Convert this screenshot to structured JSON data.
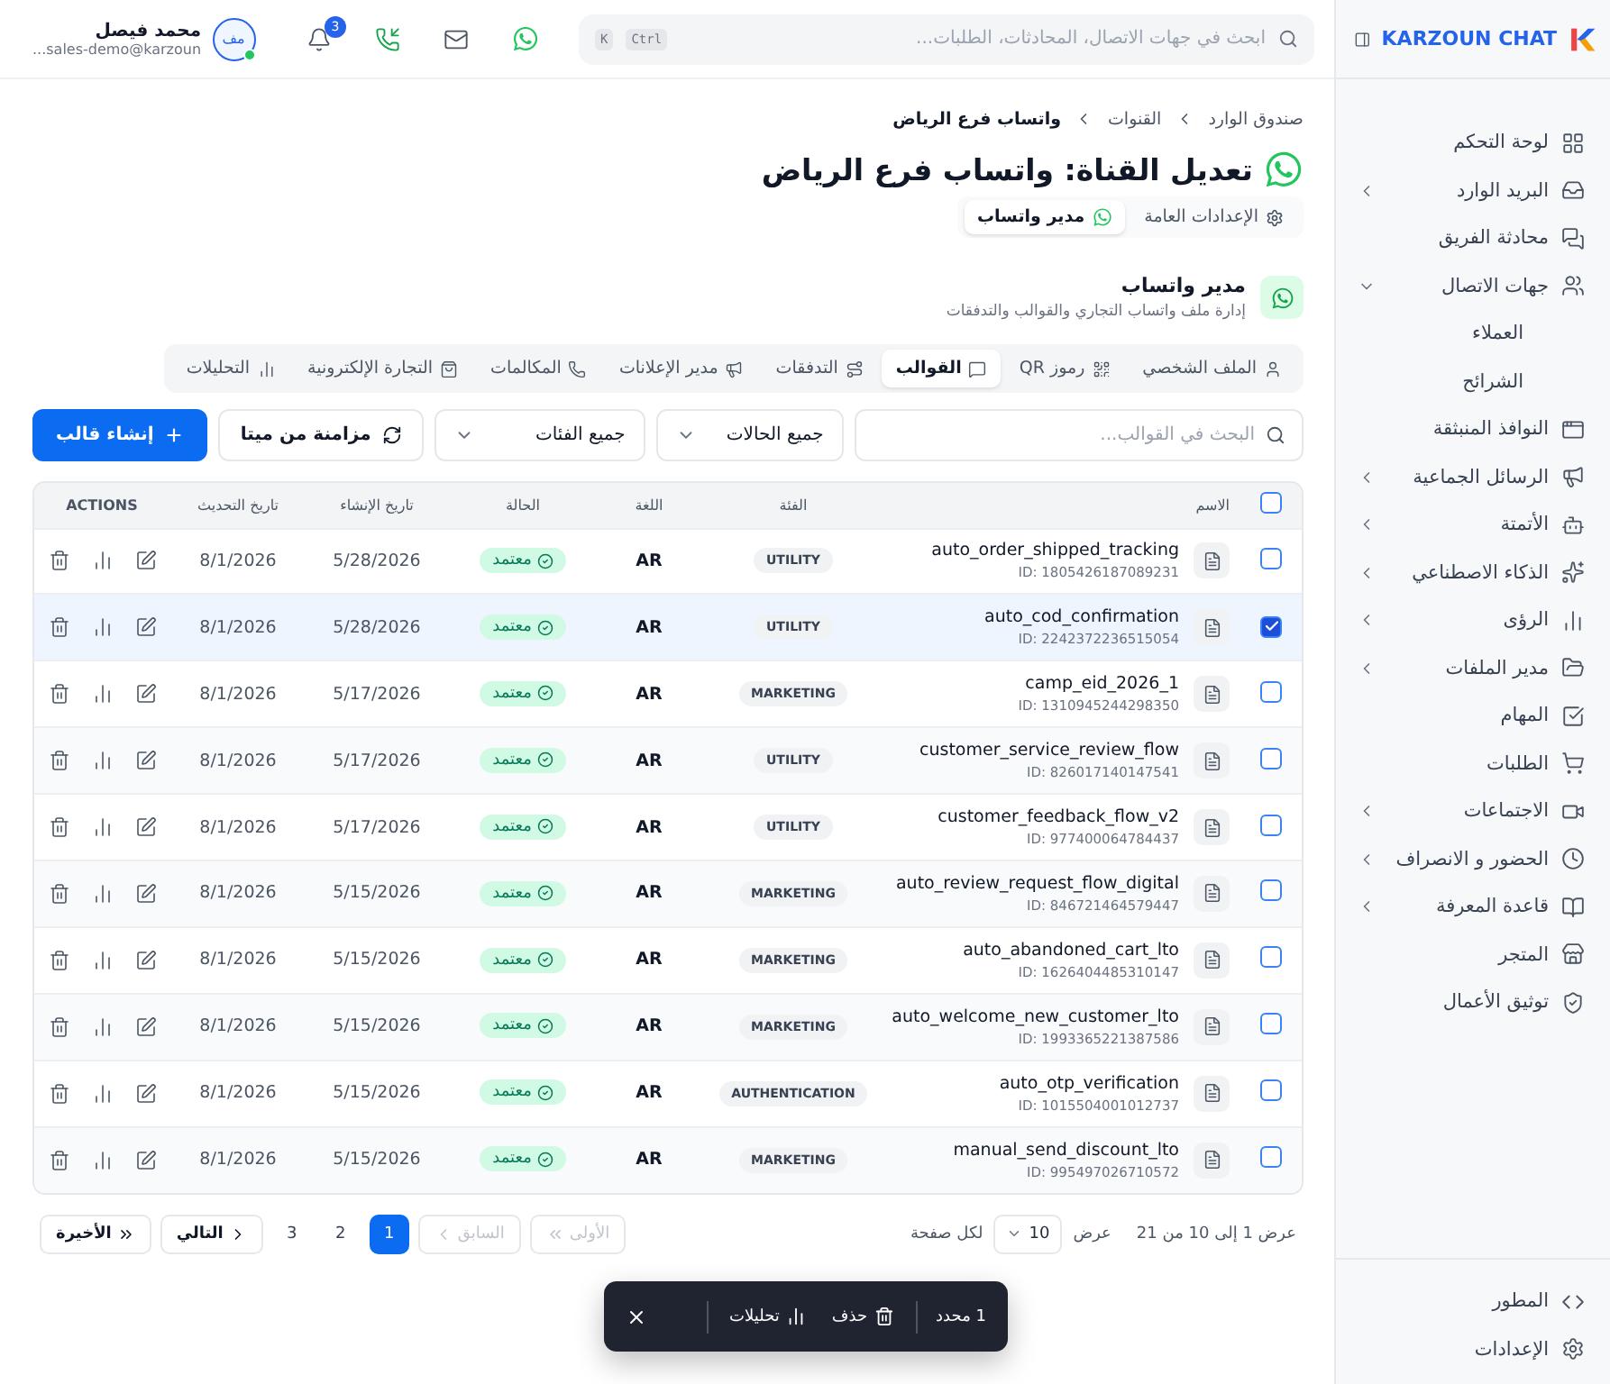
{
  "sidebar": {
    "logo": "KARZOUN CHAT",
    "items": [
      {
        "label": "لوحة التحكم"
      },
      {
        "label": "البريد الوارد",
        "expanded": false
      },
      {
        "label": "محادثة الفريق"
      },
      {
        "label": "جهات الاتصال",
        "expanded": true,
        "children": [
          {
            "label": "العملاء"
          },
          {
            "label": "الشرائح"
          }
        ]
      },
      {
        "label": "النوافذ المنبثقة"
      },
      {
        "label": "الرسائل الجماعية",
        "expanded": false
      },
      {
        "label": "الأتمتة",
        "expanded": false
      },
      {
        "label": "الذكاء الاصطناعي",
        "expanded": false
      },
      {
        "label": "الرؤى",
        "expanded": false
      },
      {
        "label": "مدير الملفات",
        "expanded": false
      },
      {
        "label": "المهام"
      },
      {
        "label": "الطلبات"
      },
      {
        "label": "الاجتماعات",
        "expanded": false
      },
      {
        "label": "الحضور و الانصراف",
        "expanded": false
      },
      {
        "label": "قاعدة المعرفة",
        "expanded": false
      },
      {
        "label": "المتجر"
      },
      {
        "label": "توثيق الأعمال"
      }
    ],
    "footer": [
      {
        "label": "المطور"
      },
      {
        "label": "الإعدادات"
      }
    ]
  },
  "header": {
    "search": {
      "placeholder": "ابحث في جهات الاتصال، المحادثات، الطلبات...",
      "keys": [
        "Ctrl",
        "K"
      ]
    },
    "notifications": "3",
    "user": {
      "initials": "مف",
      "name": "محمد فيصل",
      "email": "sales-demo@karzoun...",
      "online": true
    }
  },
  "breadcrumb": [
    "صندوق الوارد",
    "القنوات",
    "واتساب فرع الرياض"
  ],
  "title": "تعديل القناة: واتساب فرع الرياض",
  "channel_tabs": [
    {
      "label": "الإعدادات العامة",
      "selected": false
    },
    {
      "label": "مدير واتساب",
      "selected": true
    }
  ],
  "section": {
    "title": "مدير واتساب",
    "subtitle": "إدارة ملف واتساب التجاري والقوالب والتدفقات"
  },
  "tabs": [
    {
      "label": "الملف الشخصي",
      "selected": false
    },
    {
      "label": "رموز QR",
      "selected": false
    },
    {
      "label": "القوالب",
      "selected": true
    },
    {
      "label": "التدفقات",
      "selected": false
    },
    {
      "label": "مدير الإعلانات",
      "selected": false
    },
    {
      "label": "المكالمات",
      "selected": false
    },
    {
      "label": "التجارة الإلكترونية",
      "selected": false
    },
    {
      "label": "التحليلات",
      "selected": false
    }
  ],
  "toolbar": {
    "search_placeholder": "البحث في القوالب...",
    "filters": [
      "جميع الحالات",
      "جميع الفئات"
    ],
    "sync": "مزامنة من ميتا",
    "create": "إنشاء قالب"
  },
  "table": {
    "select_all": false,
    "columns": [
      "الاسم",
      "الفئة",
      "اللغة",
      "الحالة",
      "تاريخ الإنشاء",
      "تاريخ التحديث",
      "ACTIONS"
    ],
    "rows": [
      {
        "name": "auto_order_shipped_tracking",
        "id": "ID: 1805426187089231",
        "category": "UTILITY",
        "language": "AR",
        "status": "معتمد",
        "created": "5/28/2026",
        "updated": "8/1/2026",
        "selected": false
      },
      {
        "name": "auto_cod_confirmation",
        "id": "ID: 2242372236515054",
        "category": "UTILITY",
        "language": "AR",
        "status": "معتمد",
        "created": "5/28/2026",
        "updated": "8/1/2026",
        "selected": true
      },
      {
        "name": "camp_eid_2026_1",
        "id": "ID: 1310945244298350",
        "category": "MARKETING",
        "language": "AR",
        "status": "معتمد",
        "created": "5/17/2026",
        "updated": "8/1/2026",
        "selected": false
      },
      {
        "name": "customer_service_review_flow",
        "id": "ID: 826017140147541",
        "category": "UTILITY",
        "language": "AR",
        "status": "معتمد",
        "created": "5/17/2026",
        "updated": "8/1/2026",
        "selected": false
      },
      {
        "name": "customer_feedback_flow_v2",
        "id": "ID: 977400064784437",
        "category": "UTILITY",
        "language": "AR",
        "status": "معتمد",
        "created": "5/17/2026",
        "updated": "8/1/2026",
        "selected": false
      },
      {
        "name": "auto_review_request_flow_digital",
        "id": "ID: 846721464579447",
        "category": "MARKETING",
        "language": "AR",
        "status": "معتمد",
        "created": "5/15/2026",
        "updated": "8/1/2026",
        "selected": false
      },
      {
        "name": "auto_abandoned_cart_lto",
        "id": "ID: 1626404485310147",
        "category": "MARKETING",
        "language": "AR",
        "status": "معتمد",
        "created": "5/15/2026",
        "updated": "8/1/2026",
        "selected": false
      },
      {
        "name": "auto_welcome_new_customer_lto",
        "id": "ID: 1993365221387586",
        "category": "MARKETING",
        "language": "AR",
        "status": "معتمد",
        "created": "5/15/2026",
        "updated": "8/1/2026",
        "selected": false
      },
      {
        "name": "auto_otp_verification",
        "id": "ID: 1015504001012737",
        "category": "AUTHENTICATION",
        "language": "AR",
        "status": "معتمد",
        "created": "5/15/2026",
        "updated": "8/1/2026",
        "selected": false
      },
      {
        "name": "manual_send_discount_lto",
        "id": "ID: 995497026710572",
        "category": "MARKETING",
        "language": "AR",
        "status": "معتمد",
        "created": "5/15/2026",
        "updated": "8/1/2026",
        "selected": false
      }
    ]
  },
  "pagination": {
    "summary": "عرض 1 إلى 10 من 21",
    "show": "عرض",
    "per_page": "10",
    "per_page_suffix": "لكل صفحة",
    "first": {
      "label": "الأولى",
      "disabled": true
    },
    "prev": {
      "label": "السابق",
      "disabled": true
    },
    "pages": [
      {
        "label": "1",
        "selected": true
      },
      {
        "label": "2",
        "selected": false
      },
      {
        "label": "3",
        "selected": false
      }
    ],
    "next": {
      "label": "التالي",
      "disabled": false
    },
    "last": {
      "label": "الأخيرة",
      "disabled": false
    }
  },
  "bulk_bar": {
    "count": "1 محدد",
    "delete": "حذف",
    "analytics": "تحليلات"
  }
}
